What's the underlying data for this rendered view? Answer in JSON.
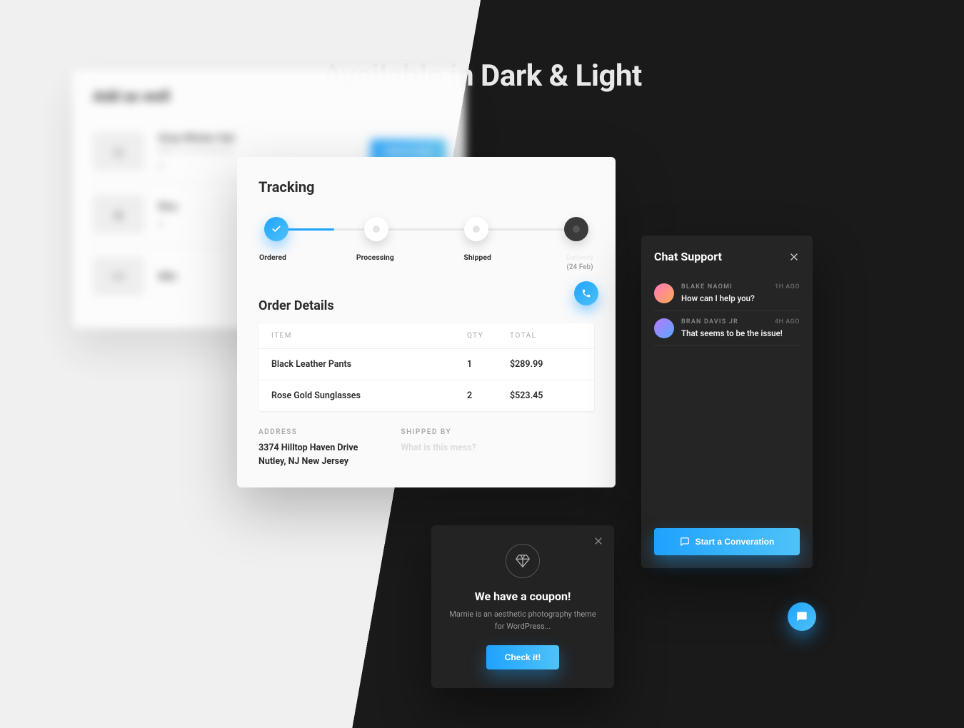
{
  "hero": {
    "title": "Available in Dark & Light"
  },
  "addaswell": {
    "title": "Add as well",
    "addcart_label": "Add to Cart",
    "items": [
      {
        "name": "Grey Winter Hat",
        "category": "MEN, ACCESSORIES",
        "qty": "2"
      },
      {
        "name": "Rou",
        "category": "",
        "qty": "2"
      },
      {
        "name": "Min",
        "category": "",
        "qty": ""
      }
    ]
  },
  "tracking": {
    "title": "Tracking",
    "steps": [
      {
        "label": "Ordered",
        "state": "done"
      },
      {
        "label": "Processing",
        "state": "pending"
      },
      {
        "label": "Shipped",
        "state": "pending"
      },
      {
        "label": "Delivery",
        "sub": "(24 Feb)",
        "state": "pending"
      }
    ],
    "order_details_title": "Order Details",
    "columns": {
      "item": "ITEM",
      "qty": "QTY",
      "total": "TOTAL"
    },
    "rows": [
      {
        "item": "Black Leather Pants",
        "qty": "1",
        "total": "$289.99"
      },
      {
        "item": "Rose Gold Sunglasses",
        "qty": "2",
        "total": "$523.45"
      }
    ],
    "address_label": "ADDRESS",
    "address_lines": "3374 Hilltop Haven Drive\nNutley, NJ New Jersey",
    "shippedby_label": "SHIPPED BY",
    "shippedby_value": "What is this mess?"
  },
  "chat": {
    "title": "Chat Support",
    "messages": [
      {
        "name": "BLAKE NAOMI",
        "time": "1H AGO",
        "text": "How can I help you?"
      },
      {
        "name": "BRAN DAVIS JR",
        "time": "4H AGO",
        "text": "That seems to be the issue!"
      }
    ],
    "cta": "Start a Converation"
  },
  "coupon": {
    "title": "We have a coupon!",
    "body": "Marnie is an aesthetic photography theme for WordPress...",
    "cta": "Check it!"
  }
}
